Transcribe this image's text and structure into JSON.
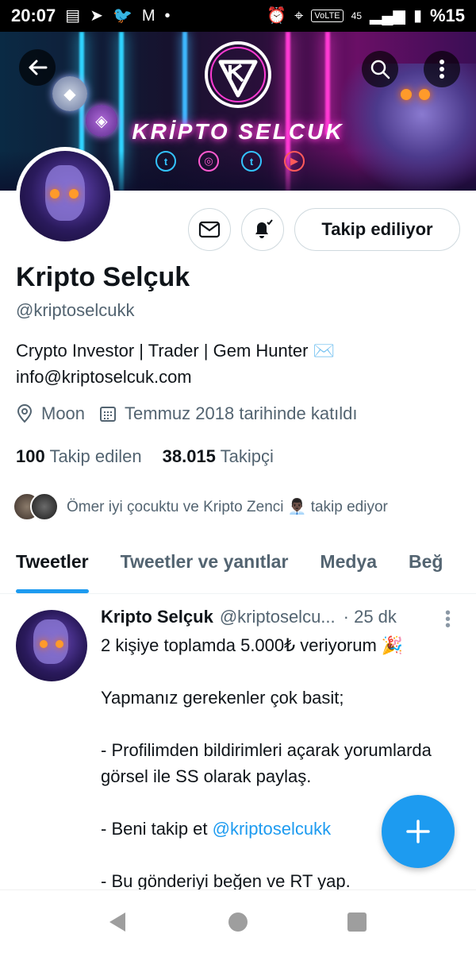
{
  "status_bar": {
    "time": "20:07",
    "volte": "VoLTE",
    "network": "45",
    "battery": "%15"
  },
  "banner": {
    "title": "KRİPTO SELCUK",
    "social_icons": [
      "twitter-icon",
      "instagram-icon",
      "tumblr-icon",
      "youtube-icon"
    ]
  },
  "profile": {
    "name": "Kripto Selçuk",
    "handle": "@kriptoselcukk",
    "bio_line1": "Crypto Investor | Trader | Gem Hunter ✉️",
    "bio_line2": "info@kriptoselcuk.com",
    "location": "Moon",
    "joined": "Temmuz 2018 tarihinde katıldı",
    "following_count": "100",
    "following_label": "Takip edilen",
    "followers_count": "38.015",
    "followers_label": "Takipçi",
    "followed_by": "Ömer iyi çocuktu ve Kripto Zenci 👨🏿‍💼 takip ediyor",
    "follow_button": "Takip ediliyor"
  },
  "tabs": [
    "Tweetler",
    "Tweetler ve yanıtlar",
    "Medya",
    "Beğ"
  ],
  "tweet": {
    "author": "Kripto Selçuk",
    "handle": "@kriptoselcu...",
    "time": "· 25 dk",
    "line1": "2 kişiye toplamda 5.000₺ veriyorum 🎉",
    "line2": "Yapmanız gerekenler çok basit;",
    "line3": "- Profilimden bildirimleri açarak yorumlarda görsel ile SS olarak paylaş.",
    "line4_prefix": "- Beni takip et ",
    "line4_link": "@kriptoselcukk",
    "line5": "- Bu gönderiyi beğen ve RT yap."
  },
  "colors": {
    "accent": "#1d9bf0",
    "text": "#0f1419",
    "muted": "#536471"
  }
}
